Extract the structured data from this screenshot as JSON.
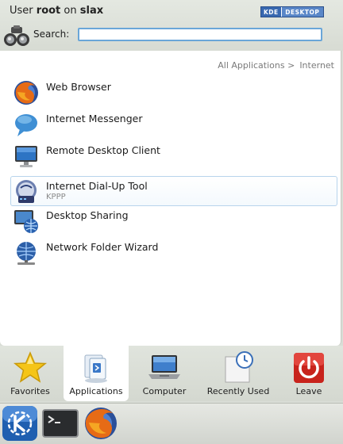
{
  "header": {
    "user_prefix": "User",
    "user_name": "root",
    "host_prefix": "on",
    "host_name": "slax",
    "badge_left": "KDE",
    "badge_right": "DESKTOP"
  },
  "search": {
    "label": "Search:",
    "value": "",
    "placeholder": ""
  },
  "breadcrumb": {
    "root": "All Applications >",
    "current": "Internet"
  },
  "apps": [
    {
      "name": "Web Browser",
      "sub": "",
      "icon": "firefox-icon"
    },
    {
      "name": "Internet Messenger",
      "sub": "",
      "icon": "chat-bubble-icon"
    },
    {
      "name": "Remote Desktop Client",
      "sub": "",
      "icon": "monitor-icon"
    },
    {
      "name": "Internet Dial-Up Tool",
      "sub": "KPPP",
      "icon": "dialup-icon"
    },
    {
      "name": "Desktop Sharing",
      "sub": "",
      "icon": "desktop-sharing-icon"
    },
    {
      "name": "Network Folder Wizard",
      "sub": "",
      "icon": "network-globe-icon"
    }
  ],
  "tabs": [
    {
      "label": "Favorites",
      "icon": "star-icon"
    },
    {
      "label": "Applications",
      "icon": "applications-icon"
    },
    {
      "label": "Computer",
      "icon": "laptop-icon"
    },
    {
      "label": "Recently Used",
      "icon": "clock-document-icon"
    },
    {
      "label": "Leave",
      "icon": "power-icon"
    }
  ],
  "taskbar": {
    "items": [
      "kde-menu-icon",
      "terminal-icon",
      "firefox-icon"
    ]
  },
  "colors": {
    "accent": "#6aa6d8",
    "selected_border": "#b7d4ec",
    "leave_red": "#c8231c"
  }
}
